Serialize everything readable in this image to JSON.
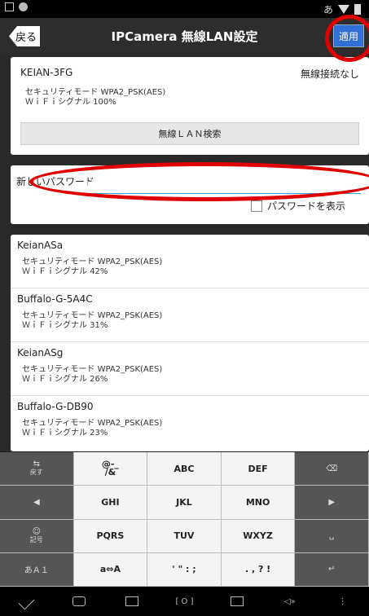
{
  "statusbar": {
    "ime_label": "あ"
  },
  "titlebar": {
    "back_label": "戻る",
    "title": "IPCamera 無線LAN設定",
    "apply_label": "適用"
  },
  "current_network": {
    "ssid": "KEIAN-3FG",
    "connection_status": "無線接続なし",
    "security": "セキュリティモード  WPA2_PSK(AES)",
    "signal": "ＷｉＦｉシグナル 100%",
    "scan_label": "無線ＬＡＮ検索"
  },
  "password": {
    "label": "新しいパスワード",
    "value": "",
    "show_label": "パスワードを表示"
  },
  "networks": [
    {
      "ssid": "KeianASa",
      "security": "セキュリティモード  WPA2_PSK(AES)",
      "signal": "ＷｉＦｉシグナル 42%"
    },
    {
      "ssid": "Buffalo-G-5A4C",
      "security": "セキュリティモード  WPA2_PSK(AES)",
      "signal": "ＷｉＦｉシグナル 31%"
    },
    {
      "ssid": "KeianASg",
      "security": "セキュリティモード  WPA2_PSK(AES)",
      "signal": "ＷｉＦｉシグナル 26%"
    },
    {
      "ssid": "Buffalo-G-DB90",
      "security": "セキュリティモード  WPA2_PSK(AES)",
      "signal": "ＷｉＦｉシグナル 23%"
    }
  ],
  "keyboard": {
    "rows": [
      [
        "⇆ 戻す",
        "@-_ /&",
        "ABC",
        "DEF",
        "⌫"
      ],
      [
        "◀",
        "GHI",
        "JKL",
        "MNO",
        "▶"
      ],
      [
        "☺ 記号",
        "PQRS",
        "TUV",
        "WXYZ",
        "␣"
      ],
      [
        "あＡ１",
        "a⇔A",
        "' \" : ;",
        ". , ? !",
        "↵"
      ]
    ]
  },
  "navbar": {
    "items": [
      "back-icon",
      "home-icon",
      "recents-icon",
      "screenshot-icon",
      "camera-icon",
      "volume-icon",
      "menu-icon"
    ]
  },
  "colors": {
    "accent": "#2f6fd6",
    "annotation": "#e10000",
    "input_underline": "#3aa0d6"
  }
}
